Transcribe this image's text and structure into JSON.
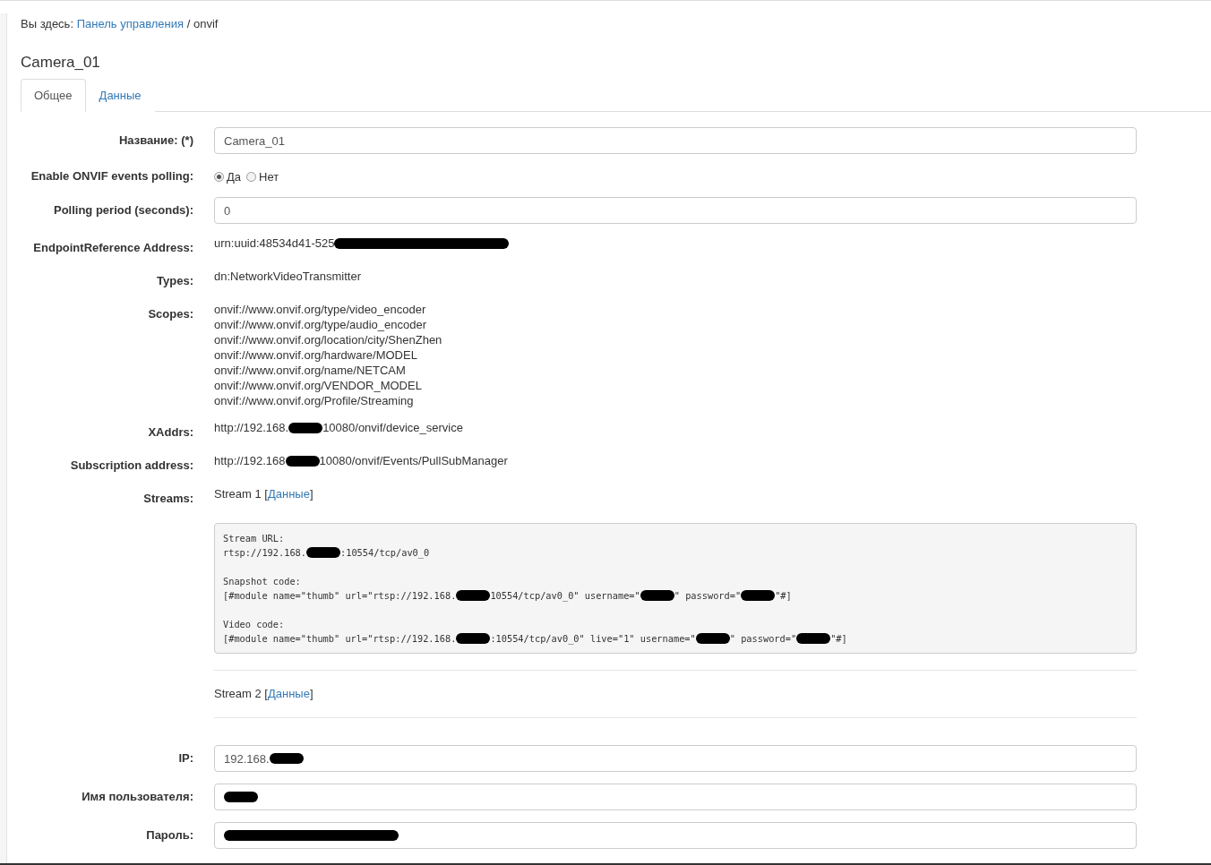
{
  "breadcrumb": {
    "prefix": "Вы здесь:",
    "link": "Панель управления",
    "separator": "/",
    "current": "onvif"
  },
  "title": "Camera_01",
  "tabs": [
    {
      "label": "Общее",
      "selected": true
    },
    {
      "label": "Данные",
      "selected": false
    }
  ],
  "fields": [
    {
      "kind": "input",
      "label": "Название: (*)",
      "value": [
        {
          "kind": "text",
          "text": "Camera_01"
        }
      ]
    },
    {
      "kind": "radio",
      "label": "Enable ONVIF events polling:",
      "options": [
        {
          "label": "Да",
          "selected": true
        },
        {
          "label": "Нет",
          "selected": false
        }
      ]
    },
    {
      "kind": "input",
      "label": "Polling period (seconds):",
      "value": [
        {
          "kind": "text",
          "text": "0"
        }
      ]
    },
    {
      "kind": "text",
      "label": "EndpointReference Address:",
      "lines": [
        [
          {
            "kind": "text",
            "text": "urn:uuid:48534d41-525"
          },
          {
            "kind": "long-mask"
          }
        ]
      ]
    },
    {
      "kind": "text",
      "label": "Types:",
      "lines": [
        [
          {
            "kind": "text",
            "text": "dn:NetworkVideoTransmitter"
          }
        ]
      ]
    },
    {
      "kind": "text",
      "label": "Scopes:",
      "lines": [
        [
          {
            "kind": "text",
            "text": "onvif://www.onvif.org/type/video_encoder"
          }
        ],
        [
          {
            "kind": "text",
            "text": "onvif://www.onvif.org/type/audio_encoder"
          }
        ],
        [
          {
            "kind": "text",
            "text": "onvif://www.onvif.org/location/city/ShenZhen"
          }
        ],
        [
          {
            "kind": "text",
            "text": "onvif://www.onvif.org/hardware/MODEL"
          }
        ],
        [
          {
            "kind": "text",
            "text": "onvif://www.onvif.org/name/NETCAM"
          }
        ],
        [
          {
            "kind": "text",
            "text": "onvif://www.onvif.org/VENDOR_MODEL"
          }
        ],
        [
          {
            "kind": "text",
            "text": "onvif://www.onvif.org/Profile/Streaming"
          }
        ]
      ]
    },
    {
      "kind": "text",
      "label": "XAddrs:",
      "lines": [
        [
          {
            "kind": "text",
            "text": "http://192.168."
          },
          {
            "kind": "mask"
          },
          {
            "kind": "text",
            "text": "10080/onvif/device_service"
          }
        ]
      ]
    },
    {
      "kind": "text",
      "label": "Subscription address:",
      "lines": [
        [
          {
            "kind": "text",
            "text": "http://192.168"
          },
          {
            "kind": "mask"
          },
          {
            "kind": "text",
            "text": "10080/onvif/Events/PullSubManager"
          }
        ]
      ]
    },
    {
      "kind": "streams",
      "label": "Streams:",
      "streams": [
        {
          "before": "Stream 1 [",
          "link": "Данные",
          "after": "]",
          "code": [
            [
              [
                {
                  "kind": "text",
                  "text": "Stream URL:"
                }
              ],
              [
                {
                  "kind": "text",
                  "text": "rtsp://192.168."
                },
                {
                  "kind": "mask"
                },
                {
                  "kind": "text",
                  "text": ":10554/tcp/av0_0"
                }
              ]
            ],
            [
              [
                {
                  "kind": "text",
                  "text": "Snapshot code:"
                }
              ],
              [
                {
                  "kind": "text",
                  "text": "[#module name=\"thumb\" url=\"rtsp://192.168."
                },
                {
                  "kind": "mask"
                },
                {
                  "kind": "text",
                  "text": "10554/tcp/av0_0\" username=\""
                },
                {
                  "kind": "mask"
                },
                {
                  "kind": "text",
                  "text": "\" password=\""
                },
                {
                  "kind": "mask"
                },
                {
                  "kind": "text",
                  "text": "\"#]"
                }
              ]
            ],
            [
              [
                {
                  "kind": "text",
                  "text": "Video code:"
                }
              ],
              [
                {
                  "kind": "text",
                  "text": "[#module name=\"thumb\" url=\"rtsp://192.168."
                },
                {
                  "kind": "mask"
                },
                {
                  "kind": "text",
                  "text": ":10554/tcp/av0_0\" live=\"1\" username=\""
                },
                {
                  "kind": "mask"
                },
                {
                  "kind": "text",
                  "text": "\" password=\""
                },
                {
                  "kind": "mask"
                },
                {
                  "kind": "text",
                  "text": "\"#]"
                }
              ]
            ]
          ]
        },
        {
          "before": "Stream 2 [",
          "link": "Данные",
          "after": "]"
        }
      ]
    },
    {
      "kind": "input",
      "label": "IP:",
      "value": [
        {
          "kind": "text",
          "text": "192.168."
        },
        {
          "kind": "mask"
        }
      ]
    },
    {
      "kind": "input",
      "label": "Имя пользователя:",
      "value": [
        {
          "kind": "mask"
        }
      ]
    },
    {
      "kind": "input",
      "label": "Пароль:",
      "value": [
        {
          "kind": "long-mask"
        }
      ]
    }
  ]
}
